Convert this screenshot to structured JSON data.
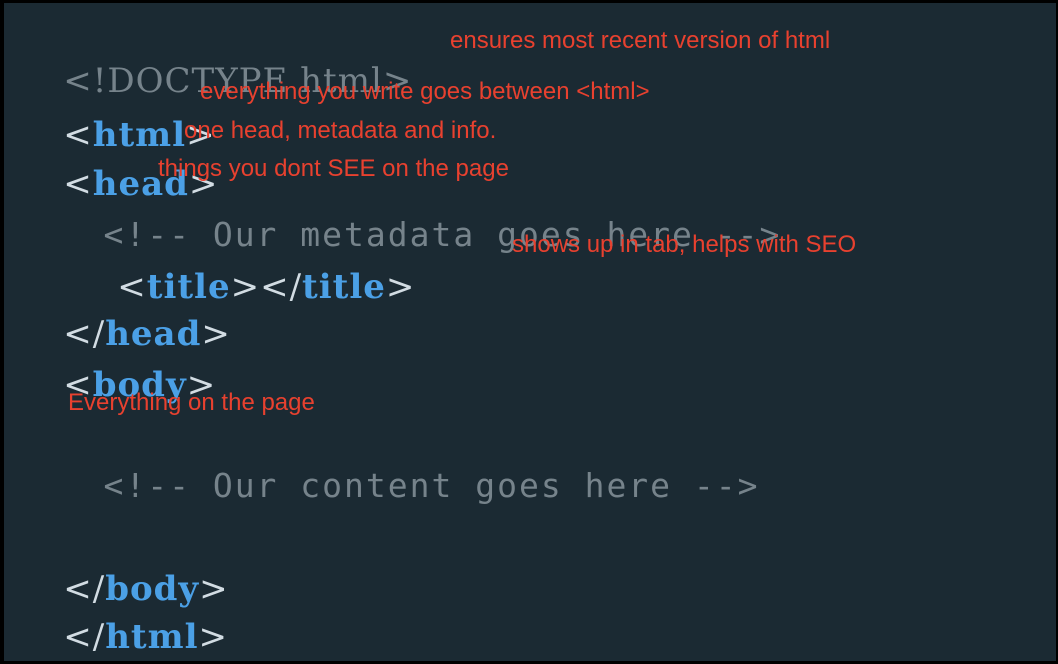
{
  "code": {
    "doctype": "<!DOCTYPE html>",
    "html_open": {
      "lt": "<",
      "name": "html",
      "gt": ">"
    },
    "head_open": {
      "lt": "<",
      "name": "head",
      "gt": ">"
    },
    "meta_comment": "<!-- Our metadata goes here -->",
    "title_line": {
      "lt1": "<",
      "name1": "title",
      "mid": "></",
      "name2": "title",
      "gt": ">"
    },
    "head_close": {
      "lt": "</",
      "name": "head",
      "gt": ">"
    },
    "body_open": {
      "lt": "<",
      "name": "body",
      "gt": ">"
    },
    "content_comment": "<!-- Our content goes here -->",
    "body_close": {
      "lt": "</",
      "name": "body",
      "gt": ">"
    },
    "html_close": {
      "lt": "</",
      "name": "html",
      "gt": ">"
    }
  },
  "annotations": {
    "doctype_note": "ensures most recent version of html",
    "html_note": "everything you write goes between <html>",
    "head_note_1": "one head, metadata and info.",
    "head_note_2": "things you dont SEE on the page",
    "title_note": "shows up in tab, helps with SEO",
    "body_note": "Everything on the page"
  },
  "colors": {
    "background": "#1b2a33",
    "tag_keyword": "#4ba0e6",
    "bracket": "#d2dce3",
    "comment": "#76838b",
    "annotation": "#e8412f"
  }
}
